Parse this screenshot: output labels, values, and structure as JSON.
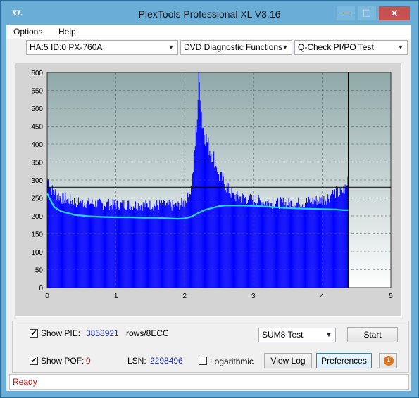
{
  "window": {
    "title": "PlexTools Professional XL V3.16",
    "icon_text": "XL"
  },
  "menu": [
    {
      "label": "Options"
    },
    {
      "label": "Help"
    }
  ],
  "toolbar": {
    "drive": "HA:5 ID:0  PX-760A",
    "function": "DVD Diagnostic Functions",
    "test": "Q-Check PI/PO Test"
  },
  "chart_data": {
    "type": "bar",
    "title": "",
    "xlabel": "",
    "ylabel": "",
    "xlim": [
      0,
      5
    ],
    "ylim": [
      0,
      600
    ],
    "x_ticks": [
      "0",
      "1",
      "2",
      "3",
      "4",
      "5"
    ],
    "y_ticks": [
      "0",
      "50",
      "100",
      "150",
      "200",
      "250",
      "300",
      "350",
      "400",
      "450",
      "500",
      "550",
      "600"
    ],
    "grid": true,
    "threshold_line": 280,
    "cursor_x": 4.38,
    "series": [
      {
        "name": "PIE",
        "kind": "bars",
        "color": "#0000ff",
        "points": [
          [
            0,
            305
          ],
          [
            0.05,
            275
          ],
          [
            0.1,
            265
          ],
          [
            0.2,
            250
          ],
          [
            0.3,
            245
          ],
          [
            0.4,
            240
          ],
          [
            0.5,
            238
          ],
          [
            0.6,
            236
          ],
          [
            0.7,
            234
          ],
          [
            0.8,
            233
          ],
          [
            0.9,
            232
          ],
          [
            1.0,
            232
          ],
          [
            1.1,
            232
          ],
          [
            1.2,
            231
          ],
          [
            1.3,
            231
          ],
          [
            1.4,
            230
          ],
          [
            1.5,
            230
          ],
          [
            1.6,
            230
          ],
          [
            1.7,
            229
          ],
          [
            1.8,
            228
          ],
          [
            1.9,
            228
          ],
          [
            2.0,
            238
          ],
          [
            2.05,
            252
          ],
          [
            2.1,
            285
          ],
          [
            2.15,
            400
          ],
          [
            2.18,
            480
          ],
          [
            2.2,
            580
          ],
          [
            2.22,
            555
          ],
          [
            2.25,
            460
          ],
          [
            2.3,
            420
          ],
          [
            2.35,
            390
          ],
          [
            2.4,
            370
          ],
          [
            2.45,
            350
          ],
          [
            2.5,
            310
          ],
          [
            2.55,
            300
          ],
          [
            2.6,
            280
          ],
          [
            2.65,
            270
          ],
          [
            2.7,
            255
          ],
          [
            2.8,
            252
          ],
          [
            2.9,
            248
          ],
          [
            3.0,
            245
          ],
          [
            3.1,
            240
          ],
          [
            3.2,
            238
          ],
          [
            3.3,
            236
          ],
          [
            3.4,
            236
          ],
          [
            3.5,
            235
          ],
          [
            3.6,
            236
          ],
          [
            3.7,
            238
          ],
          [
            3.8,
            240
          ],
          [
            3.9,
            242
          ],
          [
            4.0,
            245
          ],
          [
            4.05,
            248
          ],
          [
            4.1,
            255
          ],
          [
            4.15,
            262
          ],
          [
            4.2,
            265
          ],
          [
            4.25,
            262
          ],
          [
            4.3,
            270
          ],
          [
            4.35,
            280
          ],
          [
            4.38,
            315
          ]
        ]
      },
      {
        "name": "SUM8",
        "kind": "line",
        "color": "#22d8e8",
        "points": [
          [
            0,
            262
          ],
          [
            0.1,
            225
          ],
          [
            0.2,
            213
          ],
          [
            0.4,
            203
          ],
          [
            0.6,
            199
          ],
          [
            0.8,
            197
          ],
          [
            1.0,
            196
          ],
          [
            1.2,
            196
          ],
          [
            1.4,
            195
          ],
          [
            1.6,
            195
          ],
          [
            1.8,
            193
          ],
          [
            1.9,
            192
          ],
          [
            2.0,
            193
          ],
          [
            2.1,
            198
          ],
          [
            2.2,
            208
          ],
          [
            2.3,
            217
          ],
          [
            2.4,
            222
          ],
          [
            2.5,
            227
          ],
          [
            2.6,
            229
          ],
          [
            2.8,
            229
          ],
          [
            3.0,
            228
          ],
          [
            3.2,
            226
          ],
          [
            3.4,
            223
          ],
          [
            3.6,
            221
          ],
          [
            3.8,
            220
          ],
          [
            4.0,
            219
          ],
          [
            4.2,
            218
          ],
          [
            4.3,
            216
          ],
          [
            4.38,
            216
          ]
        ]
      }
    ]
  },
  "controls": {
    "show_pie_label": "Show PIE:",
    "pie_value": "3858921",
    "pie_unit": "rows/8ECC",
    "show_poe_label": "Show POF:",
    "poe_value": "0",
    "lsn_label": "LSN:",
    "lsn_value": "2298496",
    "logarithmic_label": "Logarithmic",
    "sum_select": "SUM8 Test",
    "start_button": "Start",
    "viewlog_button": "View Log",
    "preferences_button": "Preferences",
    "show_pie_checked": true,
    "show_poe_checked": true,
    "logarithmic_checked": false
  },
  "status": {
    "text": "Ready"
  },
  "colors": {
    "accent": "#6aaed8",
    "pie": "#0000ff",
    "sum8": "#22d8e8",
    "status": "#d01010"
  }
}
